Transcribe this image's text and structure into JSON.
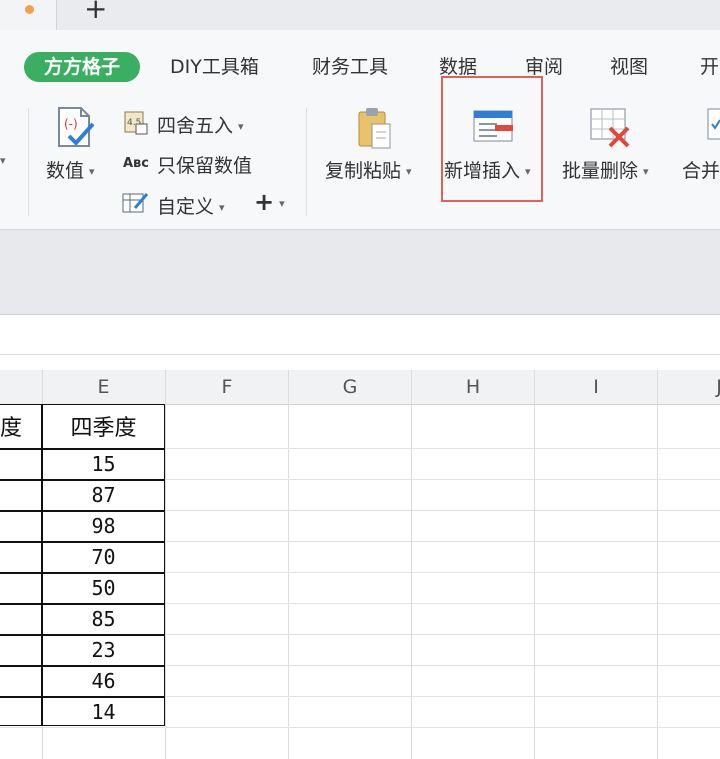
{
  "tabs": {
    "new_tab_label": "+"
  },
  "menu": {
    "brand": "方方格子",
    "items": [
      "DIY工具箱",
      "财务工具",
      "数据",
      "审阅",
      "视图",
      "开"
    ]
  },
  "ribbon": {
    "numeric_label": "数值",
    "round_label": "四舍五入",
    "keep_numeric_label": "只保留数值",
    "custom_label": "自定义",
    "plus_label": "+",
    "copy_paste_label": "复制粘贴",
    "new_insert_label": "新增插入",
    "batch_delete_label": "批量删除",
    "merge_label": "合并"
  },
  "sheet": {
    "columns": [
      "E",
      "F",
      "G",
      "H",
      "I",
      "J"
    ],
    "partial_header": "度",
    "e_header": "四季度",
    "e_values": [
      "15",
      "87",
      "98",
      "70",
      "50",
      "85",
      "23",
      "46",
      "14"
    ]
  },
  "colors": {
    "accent_green": "#3aaf61",
    "highlight_red": "#e0605a",
    "tab_dot": "#f5a048"
  }
}
